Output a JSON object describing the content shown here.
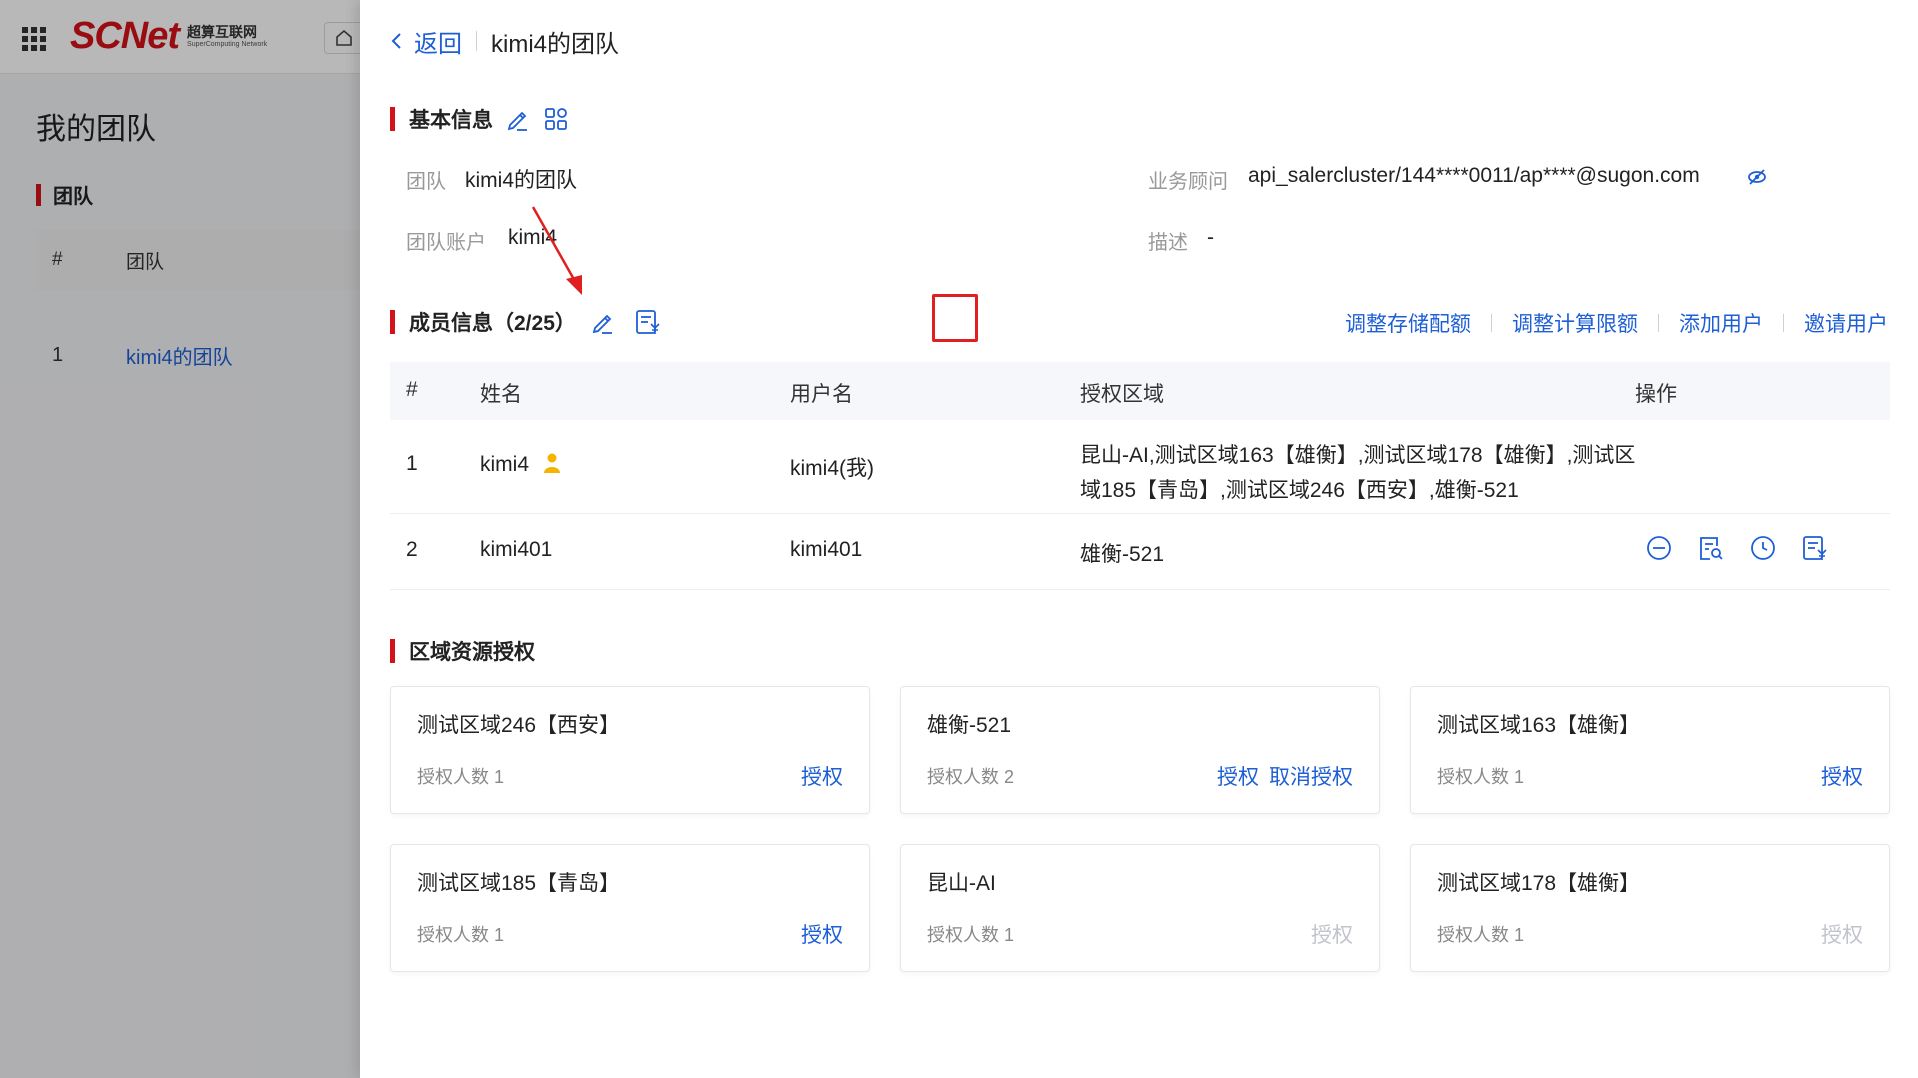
{
  "topbar": {
    "logo_main": "SCNet",
    "logo_cn": "超算互联网",
    "logo_en": "SuperComputing Network"
  },
  "background": {
    "page_title": "我的团队",
    "section_title": "团队",
    "table_headers": [
      "#",
      "团队"
    ],
    "rows": [
      {
        "index": "1",
        "name": "kimi4的团队"
      }
    ]
  },
  "drawer": {
    "back_label": "返回",
    "title": "kimi4的团队",
    "basic": {
      "title": "基本信息",
      "team_label": "团队",
      "team_value": "kimi4的团队",
      "account_label": "团队账户",
      "account_value": "kimi4",
      "advisor_label": "业务顾问",
      "advisor_value": "api_salercluster/144****0011/ap****@sugon.com",
      "desc_label": "描述",
      "desc_value": "-"
    },
    "members": {
      "title": "成员信息（2/25）",
      "actions": [
        "调整存储配额",
        "调整计算限额",
        "添加用户",
        "邀请用户"
      ],
      "headers": {
        "idx": "#",
        "name": "姓名",
        "user": "用户名",
        "region": "授权区域",
        "op": "操作"
      },
      "rows": [
        {
          "idx": "1",
          "name": "kimi4",
          "user": "kimi4(我)",
          "region": "昆山-AI,测试区域163【雄衡】,测试区域178【雄衡】,测试区域185【青岛】,测试区域246【西安】,雄衡-521"
        },
        {
          "idx": "2",
          "name": "kimi401",
          "user": "kimi401",
          "region": "雄衡-521"
        }
      ]
    },
    "regions": {
      "title": "区域资源授权",
      "count_label": "授权人数",
      "cards": [
        {
          "title": "测试区域246【西安】",
          "count": "1",
          "grant": "授权",
          "revoke": ""
        },
        {
          "title": "雄衡-521",
          "count": "2",
          "grant": "授权",
          "revoke": "取消授权"
        },
        {
          "title": "测试区域163【雄衡】",
          "count": "1",
          "grant": "授权",
          "revoke": ""
        },
        {
          "title": "测试区域185【青岛】",
          "count": "1",
          "grant": "授权",
          "revoke": ""
        },
        {
          "title": "昆山-AI",
          "count": "1",
          "grant": "授权",
          "revoke": "",
          "grant_disabled": true
        },
        {
          "title": "测试区域178【雄衡】",
          "count": "1",
          "grant": "授权",
          "revoke": "",
          "grant_disabled": true
        }
      ]
    }
  },
  "colors": {
    "accent": "#1f5fd6",
    "brand_red": "#d4121a",
    "highlight": "#e02020"
  }
}
